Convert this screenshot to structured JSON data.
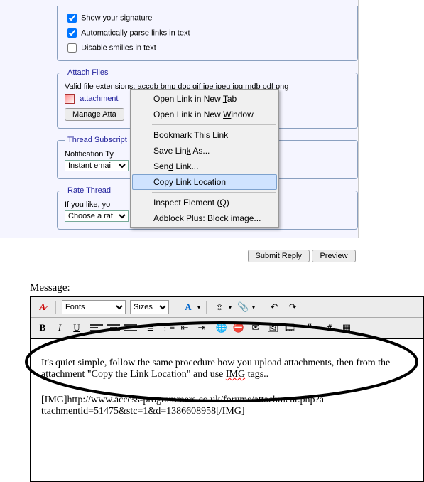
{
  "options": {
    "show_signature": "Show your signature",
    "auto_parse_links": "Automatically parse links in text",
    "disable_smilies": "Disable smilies in text"
  },
  "attach": {
    "legend": "Attach Files",
    "valid_exts": "Valid file extensions: accdb bmp doc gif jpe jpeg jpg mdb pdf png",
    "attachment_link": "attachment",
    "manage_btn": "Manage Atta"
  },
  "subscription": {
    "legend": "Thread Subscript",
    "notif_label": "Notification Ty",
    "notif_value": "Instant emai"
  },
  "rate": {
    "legend": "Rate Thread",
    "if_you_like": "If you like, yo",
    "choose": "Choose a rat"
  },
  "context_menu": {
    "items": [
      "Open Link in New Tab",
      "Open Link in New Window",
      "-",
      "Bookmark This Link",
      "Save Link As...",
      "Send Link...",
      "Copy Link Location",
      "-",
      "Inspect Element (Q)",
      "Adblock Plus: Block image..."
    ],
    "highlighted": "Copy Link Location"
  },
  "buttons": {
    "submit": "Submit Reply",
    "preview": "Preview"
  },
  "editor": {
    "label": "Message:",
    "font_combo": "Fonts",
    "size_combo": "Sizes",
    "body_line1a": "It's quiet simple, follow the same procedure how you upload attachments, then from the",
    "body_line1b_a": "attachment \"Copy the Link Location\" and use ",
    "body_line1b_wavy": "IMG",
    "body_line1b_c": " tags..",
    "body_line2": "[IMG]http://www.access-programmers.co.uk/forums/attachment.php?attachmentid=51475&stc=1&d=1386608958[/IMG]"
  },
  "icons": {
    "remove_format": "A̶",
    "color": "A",
    "smile": "☺",
    "attach": "📎",
    "undo": "↶",
    "redo": "↷",
    "bold": "B",
    "italic": "I",
    "underline": "U",
    "link": "🔗",
    "mail": "✉",
    "img": "🖼",
    "quote": "❝",
    "code": "{}",
    "html": "<>",
    "php": "php",
    "hash": "#",
    "clip": "📋"
  }
}
